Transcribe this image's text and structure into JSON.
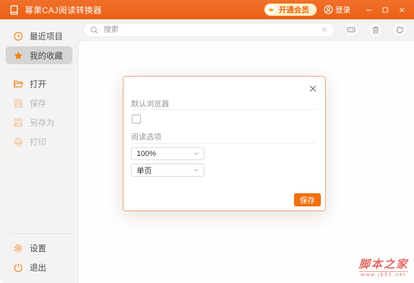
{
  "titlebar": {
    "title": "幂果CAJ阅读转换器",
    "vip_label": "开通会员",
    "login_label": "登录"
  },
  "toolbar": {
    "search_placeholder": "搜索"
  },
  "sidebar": {
    "items": [
      {
        "label": "最近项目",
        "icon": "clock-icon",
        "state": "normal"
      },
      {
        "label": "我的收藏",
        "icon": "star-icon",
        "state": "selected"
      },
      {
        "label": "打开",
        "icon": "folder-open-icon",
        "state": "normal"
      },
      {
        "label": "保存",
        "icon": "save-icon",
        "state": "disabled"
      },
      {
        "label": "另存为",
        "icon": "save-as-icon",
        "state": "disabled"
      },
      {
        "label": "打印",
        "icon": "printer-icon",
        "state": "disabled"
      }
    ],
    "footer_items": [
      {
        "label": "设置",
        "icon": "gear-icon"
      },
      {
        "label": "退出",
        "icon": "power-icon"
      }
    ]
  },
  "modal": {
    "default_browser_label": "默认浏览器",
    "checkbox_checked": false,
    "reading_options_label": "阅读选项",
    "zoom_value": "100%",
    "page_mode_value": "单页",
    "save_label": "保存"
  },
  "watermark": {
    "site_name": "脚本之家",
    "site_url": "www.jb51.net"
  },
  "colors": {
    "titlebar_orange": "#EA6114",
    "accent_orange": "#F07010",
    "disabled_icon_orange": "#F2C9A4",
    "selected_item_gray": "#D6D5D4",
    "modal_border": "#DFA67E",
    "watermark_red": "#DD5A51"
  }
}
